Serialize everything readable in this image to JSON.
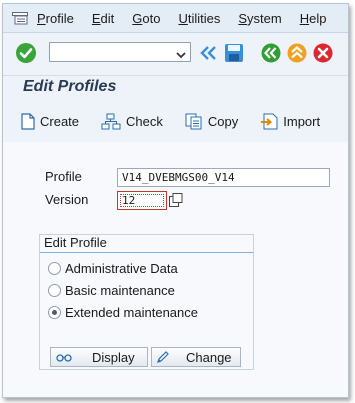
{
  "menu": {
    "items": [
      {
        "label": "Profile",
        "u": "P",
        "rest": "rofile"
      },
      {
        "label": "Edit",
        "u": "E",
        "rest": "dit"
      },
      {
        "label": "Goto",
        "u": "G",
        "rest": "oto"
      },
      {
        "label": "Utilities",
        "u": "U",
        "rest": "tilities"
      },
      {
        "label": "System",
        "u": "S",
        "rest": "ystem"
      },
      {
        "label": "Help",
        "u": "H",
        "rest": "elp"
      }
    ]
  },
  "toolbar": {
    "command_value": "",
    "icons": [
      "enter-icon",
      "fast-back-icon",
      "save-icon",
      "back-icon",
      "exit-icon",
      "cancel-icon"
    ]
  },
  "page": {
    "title": "Edit Profiles"
  },
  "app_toolbar": {
    "create": "Create",
    "check": "Check",
    "copy": "Copy",
    "import": "Import"
  },
  "form": {
    "profile_label": "Profile",
    "profile_value": "V14_DVEBMGS00_V14",
    "version_label": "Version",
    "version_value": "12"
  },
  "edit_profile": {
    "title": "Edit Profile",
    "options": [
      "Administrative Data",
      "Basic maintenance",
      "Extended maintenance"
    ],
    "selected": "Extended maintenance",
    "display_label": "Display",
    "change_label": "Change"
  },
  "colors": {
    "enter": "#3aa33a",
    "nav_green": "#2f9e33",
    "exit_orange": "#f0a020",
    "cancel_red": "#d9282f",
    "accent_blue": "#3a8fd6"
  }
}
